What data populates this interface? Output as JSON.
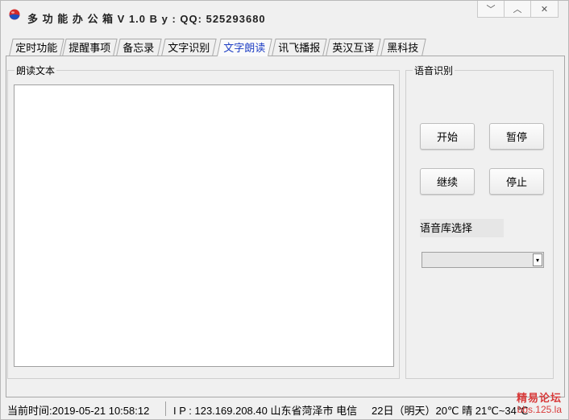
{
  "window": {
    "title": "多 功 能 办 公 箱 V 1.0    B y : QQ:  525293680",
    "minimize": "﹀",
    "maximize": "︿",
    "close": "✕"
  },
  "tabs": [
    {
      "label": "定时功能",
      "active": false
    },
    {
      "label": "提醒事项",
      "active": false
    },
    {
      "label": "备忘录",
      "active": false
    },
    {
      "label": "文字识别",
      "active": false
    },
    {
      "label": "文字朗读",
      "active": true
    },
    {
      "label": "讯飞播报",
      "active": false
    },
    {
      "label": "英汉互译",
      "active": false
    },
    {
      "label": "黑科技",
      "active": false
    }
  ],
  "read_text": {
    "group_title": "朗读文本",
    "value": ""
  },
  "speech": {
    "group_title": "语音识别",
    "start_label": "开始",
    "pause_label": "暂停",
    "continue_label": "继续",
    "stop_label": "停止",
    "voice_lib_label": "语音库选择",
    "voice_lib_value": "",
    "dropdown_icon": "▾"
  },
  "status": {
    "time": "当前时间:2019-05-21 10:58:12",
    "ip": "I P :   123.169.208.40   山东省菏泽市 电信",
    "weather": "22日（明天）20℃ 晴 21℃~34℃"
  },
  "watermark": {
    "line1": "精易论坛",
    "line2": "bbs.125.la"
  }
}
